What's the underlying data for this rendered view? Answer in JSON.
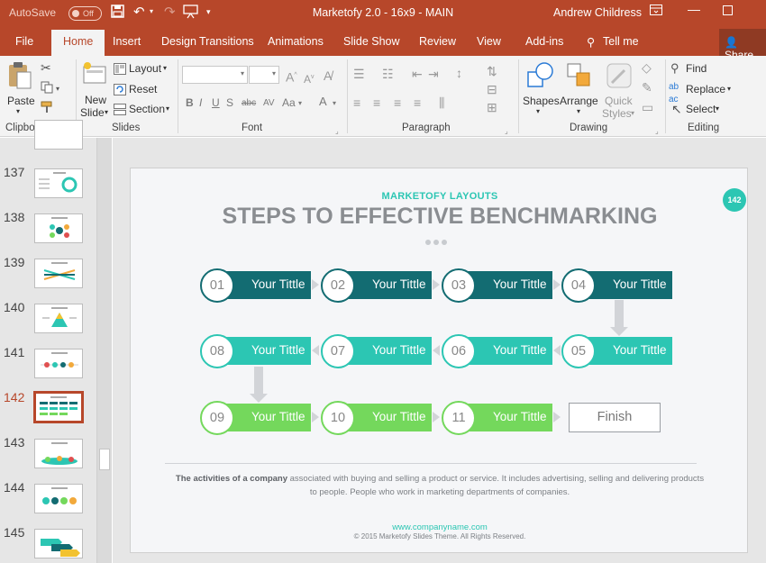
{
  "titlebar": {
    "autosave_label": "AutoSave",
    "autosave_state": "Off",
    "doc_title": "Marketofy 2.0 - 16x9 - MAIN",
    "user_name": "Andrew Childress"
  },
  "tabs": [
    "File",
    "Home",
    "Insert",
    "Design",
    "Transitions",
    "Animations",
    "Slide Show",
    "Review",
    "View",
    "Add-ins"
  ],
  "active_tab": "Home",
  "tell_me": "Tell me",
  "share": "Share",
  "ribbon": {
    "paste": "Paste",
    "clipboard": "Clipboard",
    "new_slide_line1": "New",
    "new_slide_line2": "Slide",
    "layout": "Layout",
    "reset": "Reset",
    "section": "Section",
    "slides": "Slides",
    "font": "Font",
    "paragraph": "Paragraph",
    "shapes": "Shapes",
    "arrange": "Arrange",
    "quick_line1": "Quick",
    "quick_line2": "Styles",
    "drawing": "Drawing",
    "find": "Find",
    "replace": "Replace",
    "select": "Select",
    "editing": "Editing"
  },
  "thumbnails": {
    "numbers": [
      "137",
      "138",
      "139",
      "140",
      "141",
      "142",
      "143",
      "144",
      "145"
    ],
    "active": "142"
  },
  "slide": {
    "subtitle": "MARKETOFY LAYOUTS",
    "title": "STEPS TO EFFECTIVE BENCHMARKING",
    "badge": "142",
    "steps": [
      {
        "num": "01",
        "label": "Your Tittle",
        "color": "#136c72"
      },
      {
        "num": "02",
        "label": "Your Tittle",
        "color": "#136c72"
      },
      {
        "num": "03",
        "label": "Your Tittle",
        "color": "#136c72"
      },
      {
        "num": "04",
        "label": "Your Tittle",
        "color": "#136c72"
      },
      {
        "num": "05",
        "label": "Your Tittle",
        "color": "#2cc6b3"
      },
      {
        "num": "06",
        "label": "Your Tittle",
        "color": "#2cc6b3"
      },
      {
        "num": "07",
        "label": "Your Tittle",
        "color": "#2cc6b3"
      },
      {
        "num": "08",
        "label": "Your Tittle",
        "color": "#2cc6b3"
      },
      {
        "num": "09",
        "label": "Your Tittle",
        "color": "#74d85c"
      },
      {
        "num": "10",
        "label": "Your Tittle",
        "color": "#74d85c"
      },
      {
        "num": "11",
        "label": "Your Tittle",
        "color": "#74d85c"
      }
    ],
    "finish": "Finish",
    "description_bold": "The activities of a company",
    "description_rest": " associated with buying and selling a product or service. It includes advertising, selling and delivering products to people. People who work in marketing departments of companies.",
    "footer_url": "www.companyname.com",
    "footer_copy": "© 2015 Marketofy Slides Theme. All Rights Reserved."
  },
  "colors": {
    "accent": "#b7472a",
    "dark_teal": "#136c72",
    "teal": "#2cc6b3",
    "green": "#74d85c"
  }
}
